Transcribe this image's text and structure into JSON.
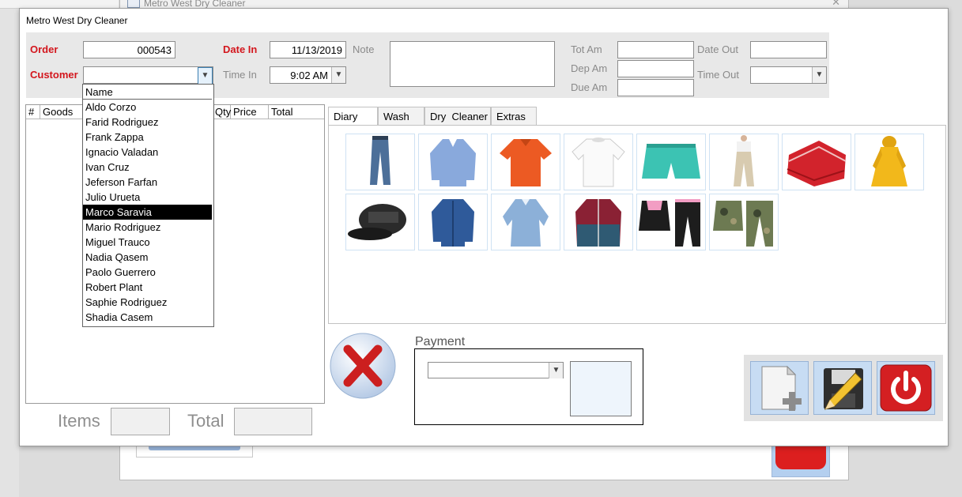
{
  "background_window": {
    "title": "Metro West Dry Cleaner"
  },
  "dialog": {
    "title": "Metro West Dry Cleaner"
  },
  "header": {
    "order_label": "Order",
    "order_value": "000543",
    "customer_label": "Customer",
    "customer_value": "",
    "date_in_label": "Date In",
    "date_in_value": "11/13/2019",
    "time_in_label": "Time In",
    "time_in_value": "9:02 AM",
    "note_label": "Note",
    "tot_am_label": "Tot  Am",
    "dep_am_label": "Dep Am",
    "due_am_label": "Due Am",
    "date_out_label": "Date Out",
    "time_out_label": "Time Out"
  },
  "goods_grid": {
    "columns": [
      "#",
      "Goods",
      "Qty",
      "Price",
      "Total"
    ]
  },
  "customer_dropdown": {
    "header": "Name",
    "items": [
      "Aldo Corzo",
      "Farid Rodriguez",
      "Frank Zappa",
      "Ignacio Valadan",
      "Ivan Cruz",
      "Jeferson Farfan",
      "Julio Urueta",
      "Marco Saravia",
      "Mario Rodriguez",
      "Miguel Trauco",
      "Nadia Qasem",
      "Paolo Guerrero",
      "Robert Plant",
      "Saphie Rodriguez",
      "Shadia Casem"
    ],
    "selected": "Marco Saravia"
  },
  "tabs": [
    "Diary",
    "Wash",
    "Dry  Cleaner",
    "Extras"
  ],
  "active_tab": "Diary",
  "garments": [
    "jeans",
    "blue-dress-shirt",
    "orange-polo",
    "white-tshirt",
    "teal-shorts",
    "khaki-pants",
    "red-blanket",
    "yellow-raincoat",
    "black-cap",
    "denim-shirt",
    "light-denim-blouse",
    "maroon-jacket",
    "pink-black-tracksuit",
    "camo-uniform"
  ],
  "payment": {
    "label": "Payment",
    "method": "",
    "amount": ""
  },
  "footer": {
    "items_label": "Items",
    "total_label": "Total",
    "items_value": "",
    "total_value": ""
  },
  "colors": {
    "label_red": "#d3161d",
    "selected_bg": "#000000",
    "button_blue": "#c7dcf3"
  }
}
